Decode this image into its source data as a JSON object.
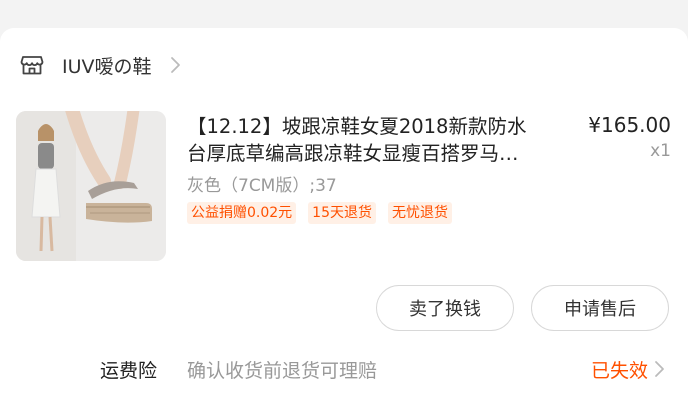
{
  "shop": {
    "name": "IUV嗳の鞋"
  },
  "product": {
    "title_line1": "【12.12】坡跟凉鞋女夏2018新款防水",
    "title_line2": "台厚底草编高跟凉鞋女显瘦百搭罗马…",
    "price": "¥165.00",
    "quantity": "x1",
    "sku": "灰色（7CM版）;37",
    "tags": [
      "公益捐赠0.02元",
      "15天退货",
      "无忧退货"
    ]
  },
  "actions": {
    "sell_label": "卖了换钱",
    "service_label": "申请售后"
  },
  "insurance": {
    "label": "运费险",
    "description": "确认收货前退货可理赔",
    "status": "已失效"
  },
  "colors": {
    "accent": "#ff5000",
    "tag_bg": "#fff0e6",
    "muted_text": "#999999",
    "page_bg": "#f3f3f3"
  },
  "icons": {
    "shop": "store-icon",
    "chevron": "chevron-right-icon"
  }
}
